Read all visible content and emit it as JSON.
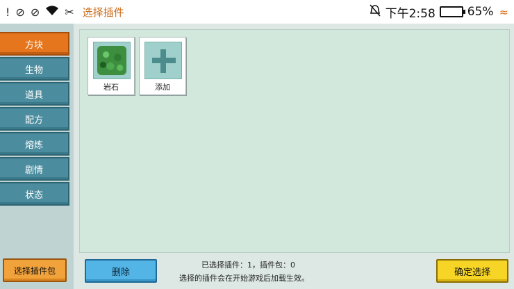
{
  "status_bar": {
    "left_icons": [
      "notification-icon",
      "no-sim-icon",
      "no-sim-icon",
      "wifi-icon",
      "cut-icon"
    ],
    "app_title": "选择插件",
    "time": "下午2:58",
    "battery_percent": "65%",
    "battery_level": 0.65
  },
  "sidebar": {
    "tabs": [
      {
        "label": "方块",
        "active": true
      },
      {
        "label": "生物",
        "active": false
      },
      {
        "label": "道具",
        "active": false
      },
      {
        "label": "配方",
        "active": false
      },
      {
        "label": "熔炼",
        "active": false
      },
      {
        "label": "剧情",
        "active": false
      },
      {
        "label": "状态",
        "active": false
      }
    ],
    "pick_pack_label": "选择插件包"
  },
  "items": [
    {
      "label": "岩石",
      "icon": "leaf-block-icon"
    },
    {
      "label": "添加",
      "icon": "plus-icon"
    }
  ],
  "footer": {
    "delete_label": "删除",
    "selection_info": "已选择插件：1，插件包：0",
    "hint": "选择的插件会在开始游戏后加载生效。",
    "confirm_label": "确定选择"
  }
}
